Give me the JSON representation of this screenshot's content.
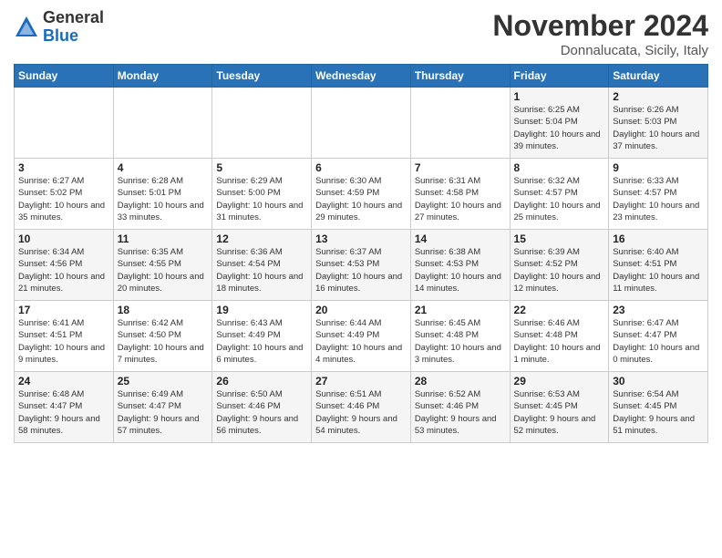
{
  "logo": {
    "general": "General",
    "blue": "Blue"
  },
  "title": "November 2024",
  "subtitle": "Donnalucata, Sicily, Italy",
  "days_of_week": [
    "Sunday",
    "Monday",
    "Tuesday",
    "Wednesday",
    "Thursday",
    "Friday",
    "Saturday"
  ],
  "weeks": [
    [
      {
        "day": "",
        "info": ""
      },
      {
        "day": "",
        "info": ""
      },
      {
        "day": "",
        "info": ""
      },
      {
        "day": "",
        "info": ""
      },
      {
        "day": "",
        "info": ""
      },
      {
        "day": "1",
        "info": "Sunrise: 6:25 AM\nSunset: 5:04 PM\nDaylight: 10 hours\nand 39 minutes."
      },
      {
        "day": "2",
        "info": "Sunrise: 6:26 AM\nSunset: 5:03 PM\nDaylight: 10 hours\nand 37 minutes."
      }
    ],
    [
      {
        "day": "3",
        "info": "Sunrise: 6:27 AM\nSunset: 5:02 PM\nDaylight: 10 hours\nand 35 minutes."
      },
      {
        "day": "4",
        "info": "Sunrise: 6:28 AM\nSunset: 5:01 PM\nDaylight: 10 hours\nand 33 minutes."
      },
      {
        "day": "5",
        "info": "Sunrise: 6:29 AM\nSunset: 5:00 PM\nDaylight: 10 hours\nand 31 minutes."
      },
      {
        "day": "6",
        "info": "Sunrise: 6:30 AM\nSunset: 4:59 PM\nDaylight: 10 hours\nand 29 minutes."
      },
      {
        "day": "7",
        "info": "Sunrise: 6:31 AM\nSunset: 4:58 PM\nDaylight: 10 hours\nand 27 minutes."
      },
      {
        "day": "8",
        "info": "Sunrise: 6:32 AM\nSunset: 4:57 PM\nDaylight: 10 hours\nand 25 minutes."
      },
      {
        "day": "9",
        "info": "Sunrise: 6:33 AM\nSunset: 4:57 PM\nDaylight: 10 hours\nand 23 minutes."
      }
    ],
    [
      {
        "day": "10",
        "info": "Sunrise: 6:34 AM\nSunset: 4:56 PM\nDaylight: 10 hours\nand 21 minutes."
      },
      {
        "day": "11",
        "info": "Sunrise: 6:35 AM\nSunset: 4:55 PM\nDaylight: 10 hours\nand 20 minutes."
      },
      {
        "day": "12",
        "info": "Sunrise: 6:36 AM\nSunset: 4:54 PM\nDaylight: 10 hours\nand 18 minutes."
      },
      {
        "day": "13",
        "info": "Sunrise: 6:37 AM\nSunset: 4:53 PM\nDaylight: 10 hours\nand 16 minutes."
      },
      {
        "day": "14",
        "info": "Sunrise: 6:38 AM\nSunset: 4:53 PM\nDaylight: 10 hours\nand 14 minutes."
      },
      {
        "day": "15",
        "info": "Sunrise: 6:39 AM\nSunset: 4:52 PM\nDaylight: 10 hours\nand 12 minutes."
      },
      {
        "day": "16",
        "info": "Sunrise: 6:40 AM\nSunset: 4:51 PM\nDaylight: 10 hours\nand 11 minutes."
      }
    ],
    [
      {
        "day": "17",
        "info": "Sunrise: 6:41 AM\nSunset: 4:51 PM\nDaylight: 10 hours\nand 9 minutes."
      },
      {
        "day": "18",
        "info": "Sunrise: 6:42 AM\nSunset: 4:50 PM\nDaylight: 10 hours\nand 7 minutes."
      },
      {
        "day": "19",
        "info": "Sunrise: 6:43 AM\nSunset: 4:49 PM\nDaylight: 10 hours\nand 6 minutes."
      },
      {
        "day": "20",
        "info": "Sunrise: 6:44 AM\nSunset: 4:49 PM\nDaylight: 10 hours\nand 4 minutes."
      },
      {
        "day": "21",
        "info": "Sunrise: 6:45 AM\nSunset: 4:48 PM\nDaylight: 10 hours\nand 3 minutes."
      },
      {
        "day": "22",
        "info": "Sunrise: 6:46 AM\nSunset: 4:48 PM\nDaylight: 10 hours\nand 1 minute."
      },
      {
        "day": "23",
        "info": "Sunrise: 6:47 AM\nSunset: 4:47 PM\nDaylight: 10 hours\nand 0 minutes."
      }
    ],
    [
      {
        "day": "24",
        "info": "Sunrise: 6:48 AM\nSunset: 4:47 PM\nDaylight: 9 hours\nand 58 minutes."
      },
      {
        "day": "25",
        "info": "Sunrise: 6:49 AM\nSunset: 4:47 PM\nDaylight: 9 hours\nand 57 minutes."
      },
      {
        "day": "26",
        "info": "Sunrise: 6:50 AM\nSunset: 4:46 PM\nDaylight: 9 hours\nand 56 minutes."
      },
      {
        "day": "27",
        "info": "Sunrise: 6:51 AM\nSunset: 4:46 PM\nDaylight: 9 hours\nand 54 minutes."
      },
      {
        "day": "28",
        "info": "Sunrise: 6:52 AM\nSunset: 4:46 PM\nDaylight: 9 hours\nand 53 minutes."
      },
      {
        "day": "29",
        "info": "Sunrise: 6:53 AM\nSunset: 4:45 PM\nDaylight: 9 hours\nand 52 minutes."
      },
      {
        "day": "30",
        "info": "Sunrise: 6:54 AM\nSunset: 4:45 PM\nDaylight: 9 hours\nand 51 minutes."
      }
    ]
  ]
}
